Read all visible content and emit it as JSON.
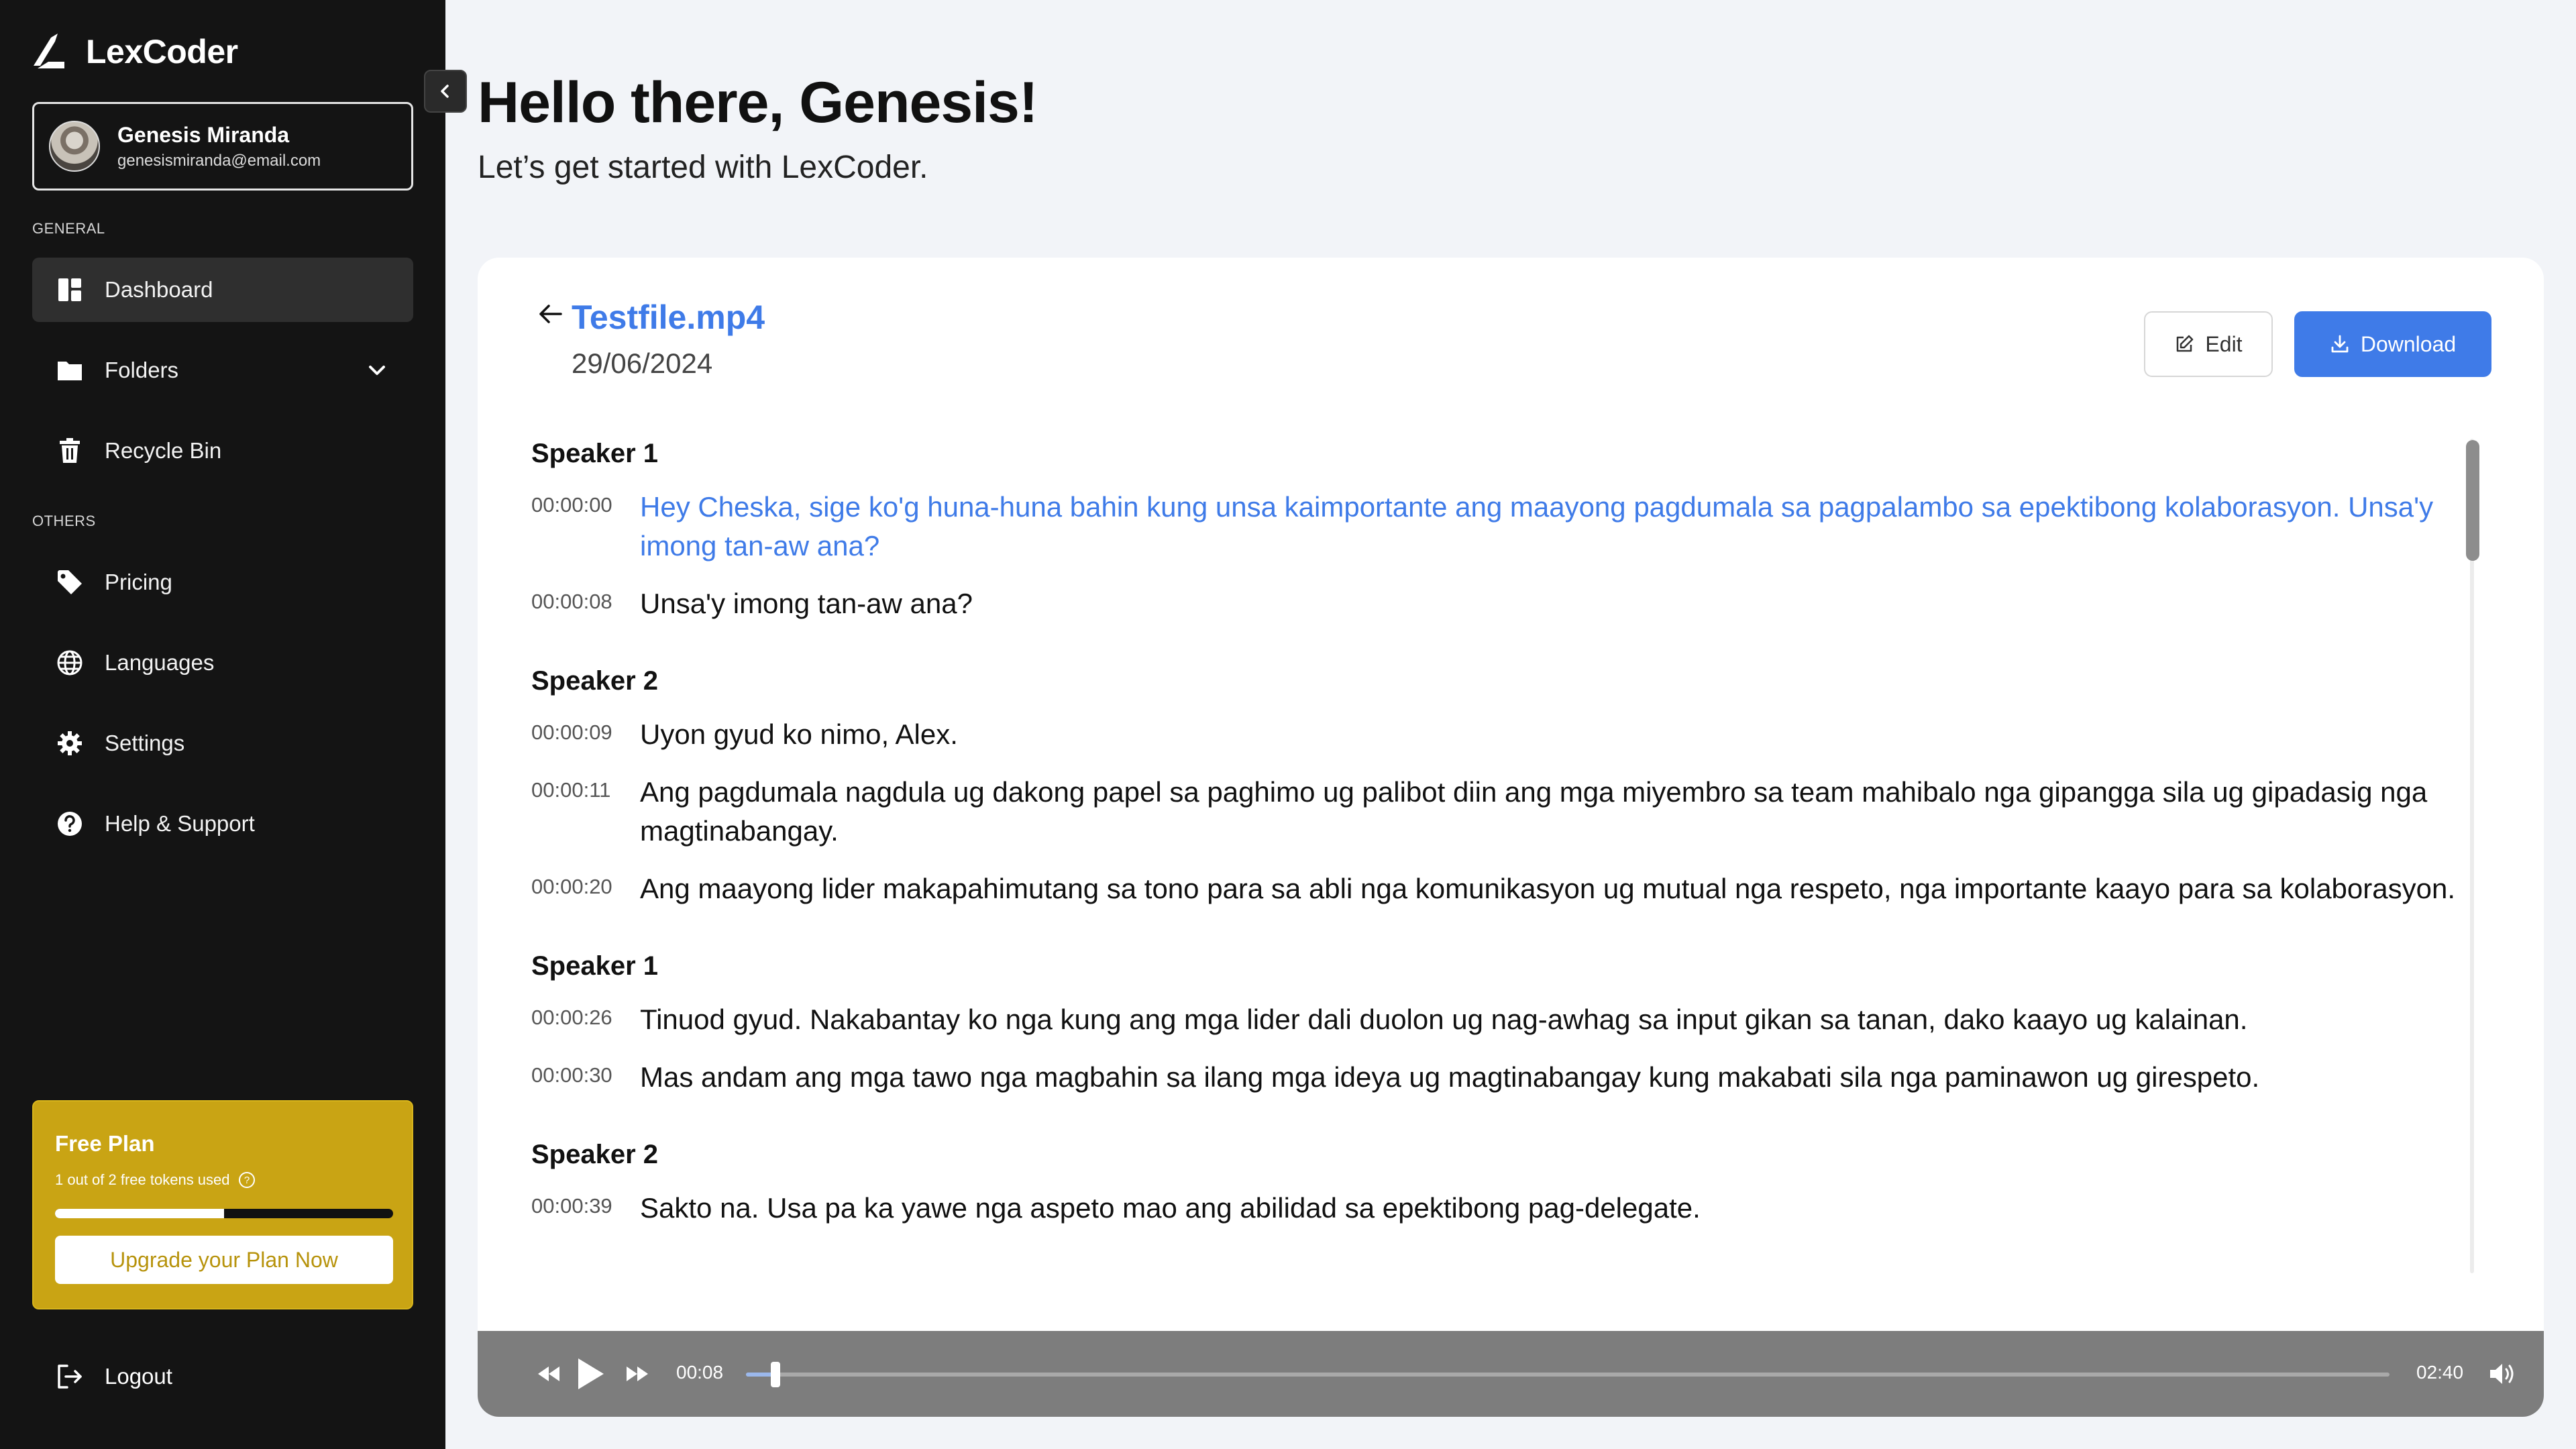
{
  "app": {
    "name": "LexCoder"
  },
  "user": {
    "name": "Genesis Miranda",
    "email": "genesismiranda@email.com"
  },
  "sidebar": {
    "general_label": "GENERAL",
    "others_label": "OTHERS",
    "items": [
      {
        "label": "Dashboard",
        "icon": "dashboard-icon",
        "active": true
      },
      {
        "label": "Folders",
        "icon": "folder-icon",
        "active": false
      },
      {
        "label": "Recycle Bin",
        "icon": "trash-icon",
        "active": false
      },
      {
        "label": "Pricing",
        "icon": "tag-icon",
        "active": false
      },
      {
        "label": "Languages",
        "icon": "globe-icon",
        "active": false
      },
      {
        "label": "Settings",
        "icon": "gear-icon",
        "active": false
      },
      {
        "label": "Help & Support",
        "icon": "help-icon",
        "active": false
      }
    ],
    "plan": {
      "title": "Free Plan",
      "tokens": "1 out of 2 free tokens used",
      "usage_fraction": 0.5,
      "upgrade_label": "Upgrade your Plan Now"
    },
    "logout_label": "Logout"
  },
  "header": {
    "greeting": "Hello there, Genesis!",
    "subtitle": "Let’s get started with LexCoder."
  },
  "file": {
    "name": "Testfile.mp4",
    "date": "29/06/2024",
    "edit_label": "Edit",
    "download_label": "Download"
  },
  "transcript": [
    {
      "speaker": "Speaker 1",
      "lines": [
        {
          "time": "00:00:00",
          "text": "Hey Cheska, sige ko'g huna-huna bahin kung unsa kaimportante ang maayong pagdumala sa pagpalambo sa epektibong kolaborasyon. Unsa'y imong tan-aw ana?",
          "highlight": true
        },
        {
          "time": "00:00:08",
          "text": "Unsa'y imong tan-aw ana?",
          "highlight": false
        }
      ]
    },
    {
      "speaker": "Speaker 2",
      "lines": [
        {
          "time": "00:00:09",
          "text": "Uyon gyud ko nimo, Alex.",
          "highlight": false
        },
        {
          "time": "00:00:11",
          "text": "Ang pagdumala nagdula ug dakong papel sa paghimo ug palibot diin ang mga miyembro sa team mahibalo nga gipangga sila ug gipadasig nga magtinabangay.",
          "highlight": false
        },
        {
          "time": "00:00:20",
          "text": "Ang maayong lider makapahimutang sa tono para sa abli nga komunikasyon ug mutual nga respeto, nga importante kaayo para sa kolaborasyon.",
          "highlight": false
        }
      ]
    },
    {
      "speaker": "Speaker 1",
      "lines": [
        {
          "time": "00:00:26",
          "text": "Tinuod gyud. Nakabantay ko nga kung ang mga lider dali duolon ug nag-awhag sa input gikan sa tanan, dako kaayo ug kalainan.",
          "highlight": false
        },
        {
          "time": "00:00:30",
          "text": "Mas andam ang mga tawo nga magbahin sa ilang mga ideya ug magtinabangay kung makabati sila nga paminawon ug girespeto.",
          "highlight": false
        }
      ]
    },
    {
      "speaker": "Speaker 2",
      "lines": [
        {
          "time": "00:00:39",
          "text": "Sakto na. Usa pa ka yawe nga aspeto mao ang abilidad sa epektibong pag-delegate.",
          "highlight": false
        }
      ]
    }
  ],
  "player": {
    "current": "00:08",
    "duration": "02:40",
    "progress_fraction": 0.018
  },
  "colors": {
    "accent": "#3f7be8",
    "plan": "#c9a414",
    "sidebar": "#141414"
  }
}
